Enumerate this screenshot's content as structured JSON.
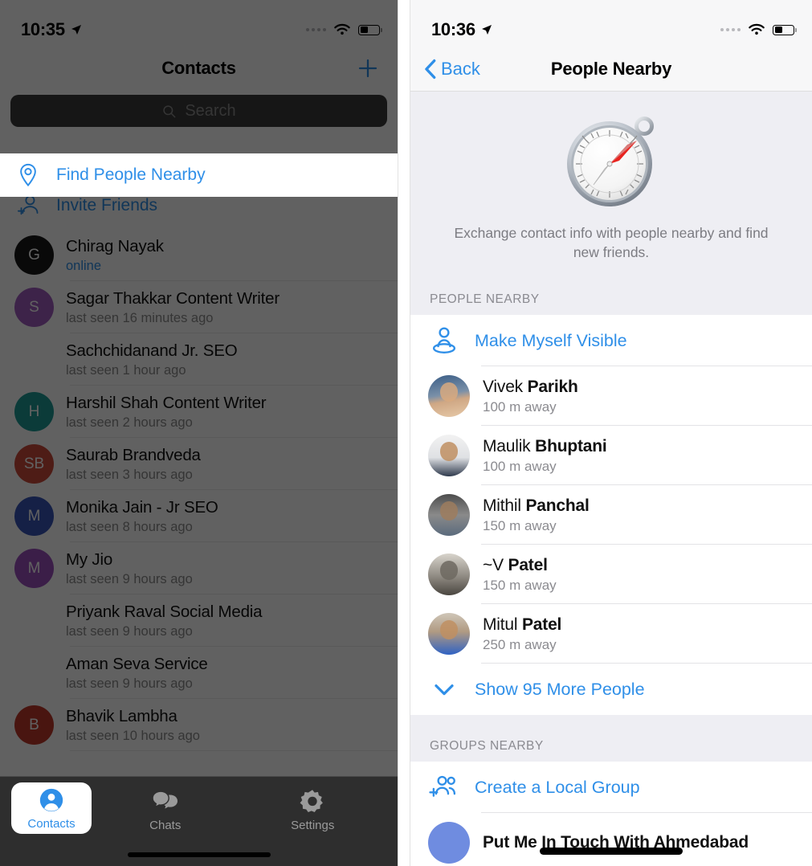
{
  "colors": {
    "accent": "#2f8fe8",
    "bg_group": "#eeeef3",
    "divider": "#e3e3e6",
    "secondary_text": "#8b8b90",
    "dim_overlay": "rgba(0,0,0,0.62)"
  },
  "left_panel": {
    "statusbar": {
      "time": "10:35",
      "location_icon": "location-arrow-icon",
      "wifi_icon": "wifi-icon",
      "battery_icon": "battery-icon",
      "cellular_icon": "cellular-dots-icon"
    },
    "navbar": {
      "title": "Contacts",
      "add_icon": "plus-icon"
    },
    "search": {
      "placeholder": "Search",
      "icon": "search-icon"
    },
    "actions": [
      {
        "label": "Find People Nearby",
        "icon": "location-pin-icon",
        "highlighted": true
      },
      {
        "label": "Invite Friends",
        "icon": "person-add-icon",
        "highlighted": false
      }
    ],
    "contacts": [
      {
        "name": "Chirag Nayak",
        "status": "online",
        "online": true,
        "initials": "G",
        "color": "#1a1a1a"
      },
      {
        "name": "Sagar Thakkar Content Writer",
        "status": "last seen 16 minutes ago",
        "online": false,
        "initials": "S",
        "color": "#a05cc0"
      },
      {
        "name": "Sachchidanand Jr. SEO",
        "status": "last seen 1 hour ago",
        "online": false,
        "initials": "",
        "color": ""
      },
      {
        "name": "Harshil Shah Content Writer",
        "status": "last seen 2 hours ago",
        "online": false,
        "initials": "H",
        "color": "#1f9c96"
      },
      {
        "name": "Saurab Brandveda",
        "status": "last seen 3 hours ago",
        "online": false,
        "initials": "SB",
        "color": "#cc4a3a"
      },
      {
        "name": "Monika Jain - Jr SEO",
        "status": "last seen 8 hours ago",
        "online": false,
        "initials": "M",
        "color": "#3754b8"
      },
      {
        "name": "My Jio",
        "status": "last seen 9 hours ago",
        "online": false,
        "initials": "M",
        "color": "#9b4fbd"
      },
      {
        "name": "Priyank Raval Social Media",
        "status": "last seen 9 hours ago",
        "online": false,
        "initials": "",
        "color": ""
      },
      {
        "name": "Aman Seva Service",
        "status": "last seen 9 hours ago",
        "online": false,
        "initials": "",
        "color": ""
      },
      {
        "name": "Bhavik Lambha",
        "status": "last seen 10 hours ago",
        "online": false,
        "initials": "B",
        "color": "#c1392b"
      }
    ],
    "tabbar": [
      {
        "label": "Contacts",
        "icon": "person-circle-icon",
        "active": true
      },
      {
        "label": "Chats",
        "icon": "chat-bubbles-icon",
        "active": false
      },
      {
        "label": "Settings",
        "icon": "gear-icon",
        "active": false
      }
    ]
  },
  "right_panel": {
    "statusbar": {
      "time": "10:36",
      "location_icon": "location-arrow-icon",
      "wifi_icon": "wifi-icon",
      "battery_icon": "battery-icon",
      "cellular_icon": "cellular-dots-icon"
    },
    "navbar": {
      "back_label": "Back",
      "back_icon": "chevron-left-icon",
      "title": "People Nearby"
    },
    "hero": {
      "icon": "compass-icon",
      "description": "Exchange contact info with people nearby and find new friends."
    },
    "people_section": {
      "header": "PEOPLE NEARBY",
      "make_visible": {
        "label": "Make Myself Visible",
        "icon": "person-pin-icon"
      },
      "people": [
        {
          "first": "Vivek ",
          "last": "Parikh",
          "distance": "100 m away"
        },
        {
          "first": "Maulik ",
          "last": "Bhuptani",
          "distance": "100 m away"
        },
        {
          "first": "Mithil ",
          "last": "Panchal",
          "distance": "150 m away"
        },
        {
          "first": "~V ",
          "last": "Patel",
          "distance": "150 m away"
        },
        {
          "first": "Mitul ",
          "last": "Patel",
          "distance": "250 m away"
        }
      ],
      "show_more": {
        "label": "Show 95 More People",
        "icon": "chevron-down-icon"
      }
    },
    "groups_section": {
      "header": "GROUPS NEARBY",
      "create_group": {
        "label": "Create a Local Group",
        "icon": "people-add-icon"
      },
      "groups": [
        {
          "name": "Put Me In Touch With Ahmedabad"
        }
      ]
    }
  }
}
